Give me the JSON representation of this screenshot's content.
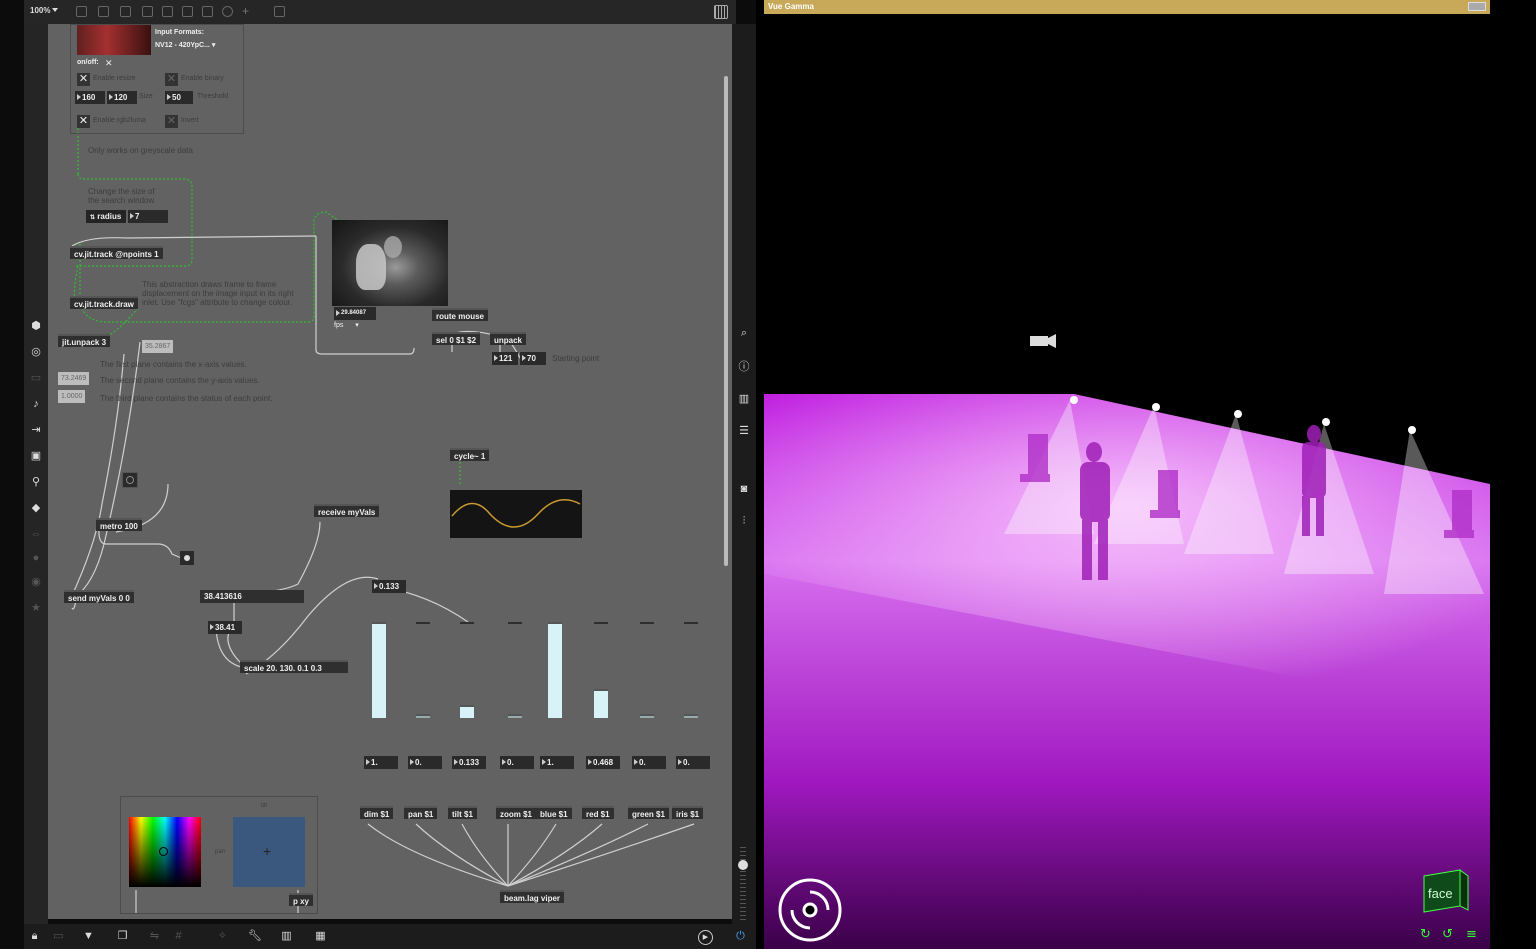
{
  "toolbar": {
    "zoom": "100%"
  },
  "grab_panel": {
    "input_formats_label": "Input Formats:",
    "input_format_value": "NV12 - 420YpC...",
    "onoff_label": "on/off:",
    "enable_resize": "Enable resize",
    "enable_binary": "Enable binary",
    "width": "160",
    "height": "120",
    "size_label": "Size",
    "threshold_value": "50",
    "threshold_label": "Threshold",
    "enable_rgb2luma": "Enable rgb2luma",
    "invert_label": "Invert"
  },
  "comments": {
    "greyscale": "Only works on greyscale data",
    "search_window_1": "Change the size of",
    "search_window_2": "the search window",
    "abstraction_1": "This abstraction draws frame to frame",
    "abstraction_2": "displacement on the image input in its right",
    "abstraction_3": "inlet. Use \"fcgs\" attribute to change colour.",
    "plane_x": "The first plane contains the x-axis values.",
    "plane_y": "The second plane contains the y-axis values.",
    "plane_status": "The third plane contains the status of each point.",
    "starting_point": "Starting point"
  },
  "objects": {
    "radius": "radius",
    "radius_value": "7",
    "track": "cv.jit.track @npoints 1",
    "track_draw": "cv.jit.track.draw",
    "unpack": "jit.unpack 3",
    "fps_value": "29.84087",
    "fps_label": "fps",
    "route_mouse": "route mouse",
    "sel": "sel 0 $1 $2",
    "unpack2": "unpack",
    "start_x": "121",
    "start_y": "70",
    "cycle": "cycle~ 1",
    "metro": "metro 100",
    "receive": "receive myVals",
    "send": "send myVals 0 0",
    "val_display": "38.413616",
    "val_num": "38.41",
    "scale": "scale 20. 130. 0.1 0.3",
    "tilt_num": "0.133",
    "msg1": "35.2867",
    "msg2": "73.2469",
    "msg3": "1.0000",
    "beam": "beam.lag viper",
    "pxy": "p xy",
    "tilt_label_small": "tilt",
    "pan_label_small": "pan"
  },
  "channels": [
    {
      "label": "dim $1",
      "value": "1.",
      "level": 1.0
    },
    {
      "label": "pan $1",
      "value": "0.",
      "level": 0.0
    },
    {
      "label": "tilt $1",
      "value": "0.133",
      "level": 0.133
    },
    {
      "label": "zoom $1",
      "value": "0.",
      "level": 0.0
    },
    {
      "label": "blue $1",
      "value": "1.",
      "level": 1.0
    },
    {
      "label": "red $1",
      "value": "0.468",
      "level": 0.3
    },
    {
      "label": "green $1",
      "value": "0.",
      "level": 0.0
    },
    {
      "label": "iris $1",
      "value": "0.",
      "level": 0.0
    }
  ],
  "viz": {
    "title": "Vue Gamma",
    "face_label": "face",
    "accent": "#c8a95a",
    "light_color": "#e030f0"
  }
}
